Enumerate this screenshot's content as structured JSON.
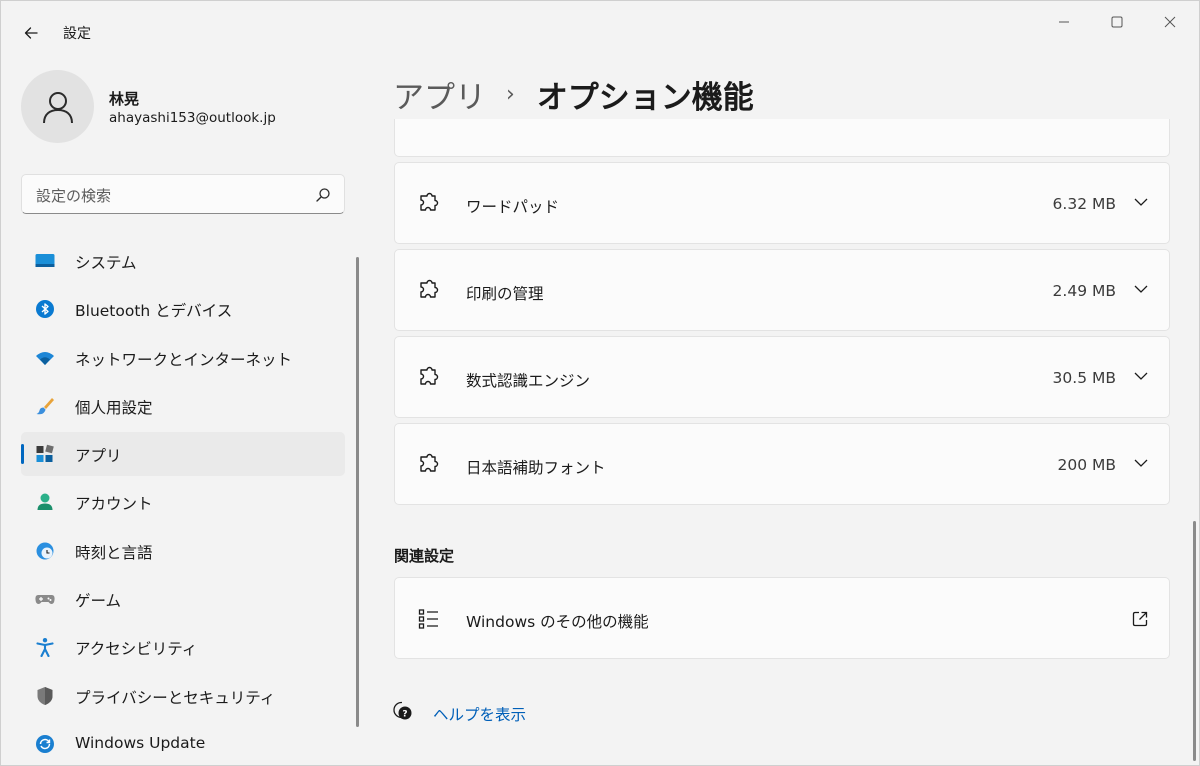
{
  "window": {
    "title": "設定",
    "controls": {
      "minimize": "minimize-icon",
      "maximize": "maximize-icon",
      "close": "close-icon"
    }
  },
  "profile": {
    "name": "林晃",
    "email": "ahayashi153@outlook.jp"
  },
  "search": {
    "placeholder": "設定の検索"
  },
  "sidebar": {
    "items": [
      {
        "label": "システム",
        "icon": "system-icon"
      },
      {
        "label": "Bluetooth とデバイス",
        "icon": "bluetooth-icon"
      },
      {
        "label": "ネットワークとインターネット",
        "icon": "wifi-icon"
      },
      {
        "label": "個人用設定",
        "icon": "brush-icon"
      },
      {
        "label": "アプリ",
        "icon": "apps-icon",
        "active": true
      },
      {
        "label": "アカウント",
        "icon": "account-icon"
      },
      {
        "label": "時刻と言語",
        "icon": "time-language-icon"
      },
      {
        "label": "ゲーム",
        "icon": "gamepad-icon"
      },
      {
        "label": "アクセシビリティ",
        "icon": "accessibility-icon"
      },
      {
        "label": "プライバシーとセキュリティ",
        "icon": "shield-icon"
      },
      {
        "label": "Windows Update",
        "icon": "windows-update-icon"
      }
    ]
  },
  "breadcrumb": {
    "parent": "アプリ",
    "separator": "›",
    "current": "オプション機能"
  },
  "features": [
    {
      "name": "ワードパッド",
      "size": "6.32 MB"
    },
    {
      "name": "印刷の管理",
      "size": "2.49 MB"
    },
    {
      "name": "数式認識エンジン",
      "size": "30.5 MB"
    },
    {
      "name": "日本語補助フォント",
      "size": "200 MB"
    }
  ],
  "related": {
    "title": "関連設定",
    "items": [
      {
        "label": "Windows のその他の機能",
        "icon": "list-icon"
      }
    ]
  },
  "help": {
    "label": "ヘルプを表示"
  },
  "colors": {
    "accent": "#0067c0",
    "link": "#005fb8",
    "background": "#f3f3f3",
    "card": "#fbfbfb"
  }
}
